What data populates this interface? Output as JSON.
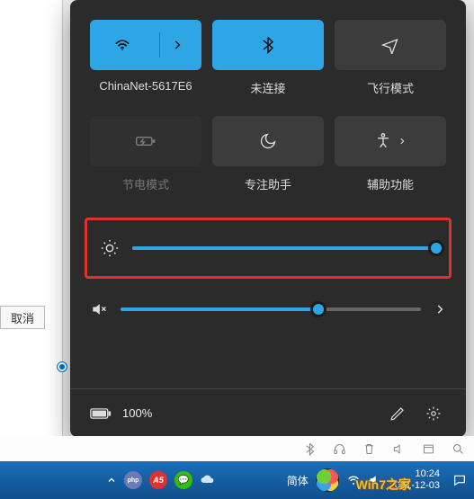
{
  "bg": {
    "cancel_btn": "取消"
  },
  "tiles": {
    "wifi": {
      "label": "ChinaNet-5617E6",
      "active": true,
      "has_chevron": true
    },
    "bluetooth": {
      "label": "未连接",
      "active": true,
      "has_chevron": false
    },
    "airplane": {
      "label": "飞行模式",
      "active": false
    },
    "battery": {
      "label": "节电模式",
      "active": false,
      "disabled": true
    },
    "focus": {
      "label": "专注助手",
      "active": false
    },
    "a11y": {
      "label": "辅助功能",
      "active": false,
      "has_chevron": true
    }
  },
  "sliders": {
    "brightness": {
      "value": 100,
      "min": 0,
      "max": 100
    },
    "volume": {
      "value": 66,
      "min": 0,
      "max": 100
    }
  },
  "bottom": {
    "battery_text": "100%"
  },
  "taskbar": {
    "ime": "简体",
    "time": "10:24",
    "date": "2021-12-03"
  },
  "watermark": "Win7之家"
}
